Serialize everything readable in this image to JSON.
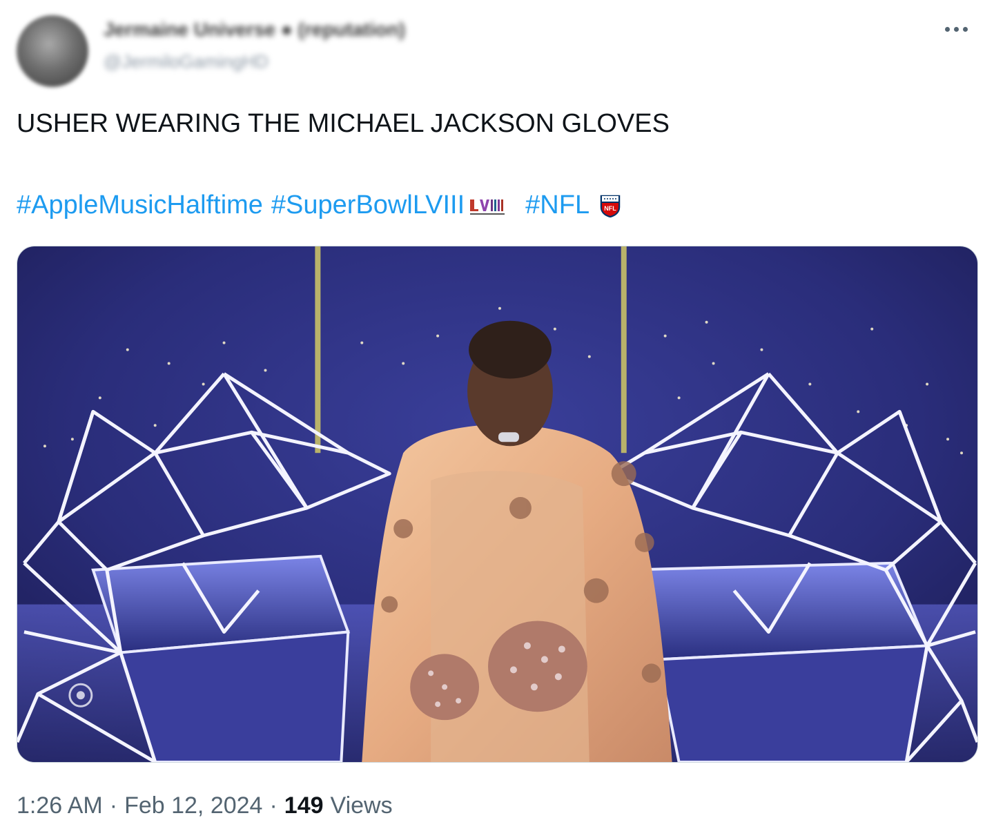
{
  "author": {
    "display_name": "Jermaine Universe ● (reputation)",
    "handle": "@JermiloGamingHD"
  },
  "tweet": {
    "text": "USHER WEARING THE MICHAEL JACKSON GLOVES",
    "hashtags": [
      "#AppleMusicHalftime",
      "#SuperBowlLVIII",
      "#NFL"
    ]
  },
  "media": {
    "watermark": "CBS eye logo",
    "icon": "photo-usher-halftime"
  },
  "footer": {
    "time": "1:26 AM",
    "date": "Feb 12, 2024",
    "separator": "·",
    "views_count": "149",
    "views_label": "Views"
  },
  "colors": {
    "hashtag": "#1d9bf0",
    "text": "#0f1419",
    "secondary": "#536471"
  }
}
